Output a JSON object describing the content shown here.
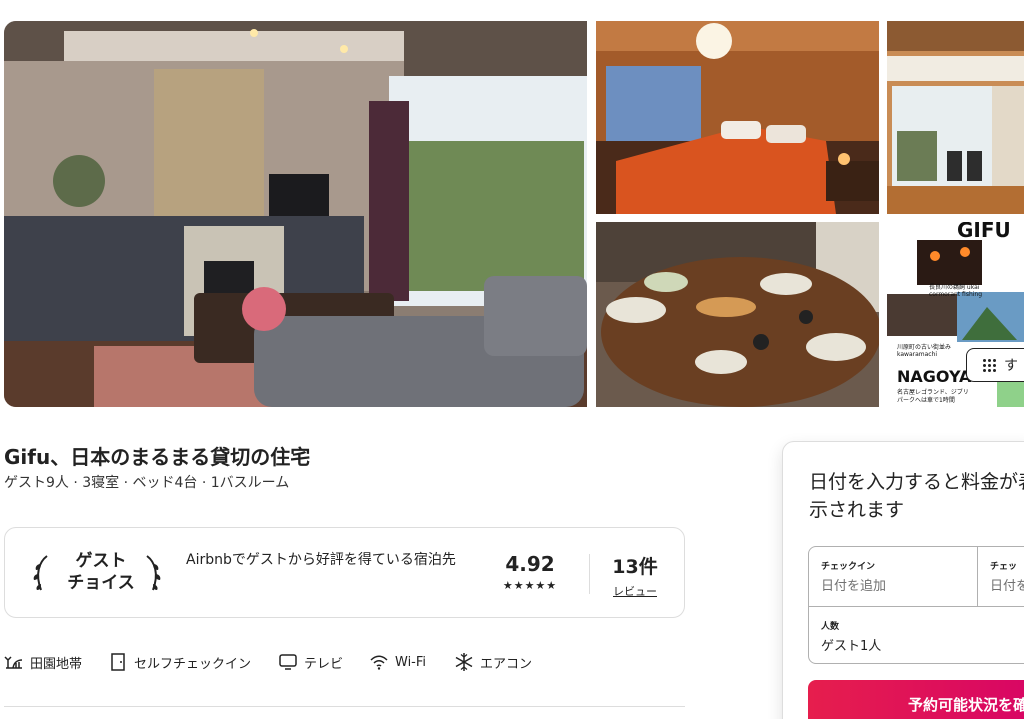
{
  "gallery": {
    "photos": [
      "living-room",
      "bedroom",
      "engawa-hallway",
      "dining-table",
      "area-map"
    ],
    "map": {
      "gifu_label": "GIFU",
      "ukai_caption": "長良川の鵜飼 ukai\ncormorant fishing",
      "kawaramachi_caption": "川原町の古い街並み\nkawaramachi",
      "nagoya_label": "NAGOYA",
      "nagoya_caption": "名古屋レゴランド、ジブリ\nパークへは車で1時間"
    },
    "show_all_label": "す"
  },
  "listing": {
    "title": "Gifu、日本のまるまる貸切の住宅",
    "summary": "ゲスト9人 · 3寝室 · ベッド4台 · 1バスルーム"
  },
  "guest_favorite": {
    "badge_line1": "ゲスト",
    "badge_line2": "チョイス",
    "description": "Airbnbでゲストから好評を得ている宿泊先",
    "rating": "4.92",
    "stars": "★★★★★",
    "review_count": "13件",
    "review_label": "レビュー"
  },
  "amenities": [
    {
      "icon": "countryside-icon",
      "label": "田園地帯"
    },
    {
      "icon": "door-icon",
      "label": "セルフチェックイン"
    },
    {
      "icon": "tv-icon",
      "label": "テレビ"
    },
    {
      "icon": "wifi-icon",
      "label": "Wi-Fi"
    },
    {
      "icon": "snowflake-icon",
      "label": "エアコン"
    }
  ],
  "booking": {
    "prompt": "日付を入力すると料金が表示されます",
    "checkin_label": "チェックイン",
    "checkin_value": "日付を追加",
    "checkout_label": "チェッ",
    "checkout_value": "日付を",
    "guests_label": "人数",
    "guests_value": "ゲスト1人",
    "cta_label": "予約可能状況を確"
  },
  "colors": {
    "accent": "#e61e4d",
    "text": "#222222",
    "muted": "#717171"
  }
}
